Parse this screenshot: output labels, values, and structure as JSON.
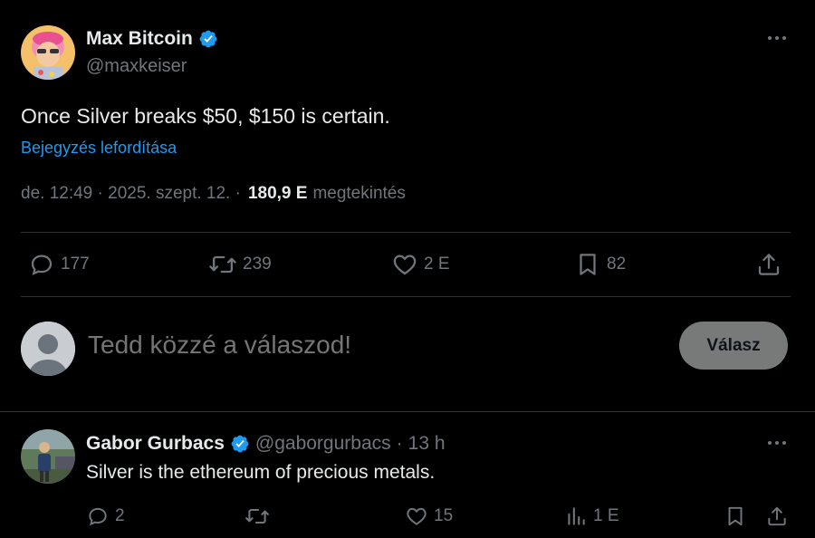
{
  "main_tweet": {
    "author_name": "Max Bitcoin",
    "author_handle": "@maxkeiser",
    "text": "Once Silver breaks $50, $150 is certain.",
    "translate_link": "Bejegyzés lefordítása",
    "timestamp": "de. 12:49 · 2025. szept. 12. ·",
    "views_count": "180,9 E",
    "views_label": "megtekintés",
    "actions": {
      "replies": "177",
      "retweets": "239",
      "likes": "2 E",
      "bookmarks": "82"
    }
  },
  "composer": {
    "placeholder": "Tedd közzé a válaszod!",
    "button_label": "Válasz"
  },
  "reply_tweet": {
    "author_name": "Gabor Gurbacs",
    "author_handle": "@gaborgurbacs",
    "separator": "·",
    "time": "13 h",
    "text": "Silver is the ethereum of precious metals.",
    "actions": {
      "replies": "2",
      "retweets": "",
      "likes": "15",
      "views": "1 E"
    }
  },
  "colors": {
    "background": "#000000",
    "text_primary": "#e7e9ea",
    "text_secondary": "#71767b",
    "accent": "#1d9bf0",
    "divider": "#2f3336",
    "verified": "#1d9bf0"
  }
}
